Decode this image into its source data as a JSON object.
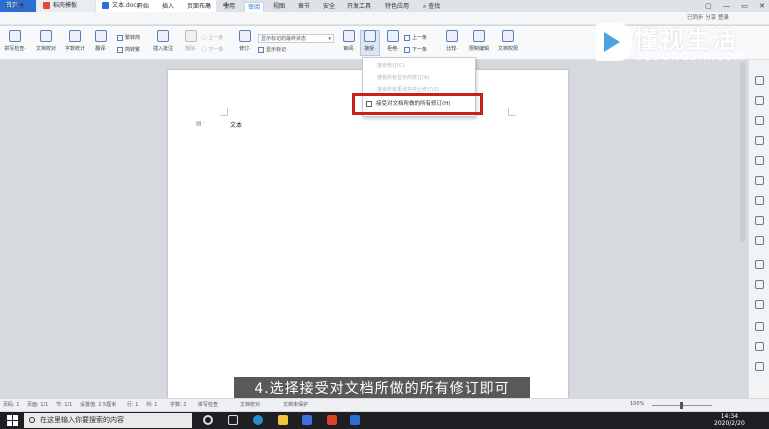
{
  "tabs": {
    "home": "首页",
    "template": "稻壳模板",
    "doc": "文本.docx",
    "add": "+"
  },
  "window_controls": [
    "▢",
    "—",
    "▭",
    "✕"
  ],
  "menu": {
    "file": "三 文件",
    "items": [
      "开始",
      "插入",
      "页面布局",
      "引用",
      "审阅",
      "视图",
      "章节",
      "安全",
      "开发工具",
      "特色应用"
    ],
    "search": "查找",
    "account": "已同步  分享  登录"
  },
  "ribbon": {
    "spell_check": "拼写检查·",
    "doc_proof": "文档校对",
    "word_count": "字数统计",
    "translate": "翻译·",
    "simp_trad": "繁转简",
    "trad_simp": "简转繁",
    "insert_comment": "插入批注",
    "delete": "删除·",
    "prev": "上一条",
    "next_dim": "下一条",
    "revise": "修订·",
    "markup_state": "显示标记的最终状态",
    "show_markup": "显示标记·",
    "review": "审阅·",
    "accept": "接受·",
    "reject": "拒绝·",
    "prev2": "上一条",
    "next2": "下一条",
    "compare": "比较·",
    "restrict_edit": "限制编辑",
    "doc_rights": "文档权限"
  },
  "dropdown": {
    "items": [
      "接受修订(C)",
      "接受所有显示的修订(A)",
      "接受所有更改并停止修订(S)"
    ],
    "accept_all": "接受对文档所做的所有修订(H)"
  },
  "document": {
    "text": "文本",
    "para_marker": "▤ ·"
  },
  "logo": {
    "cn": "懂视生活",
    "en": "51DONGSHI.COM"
  },
  "caption": "4.选择接受对文档所做的所有修订即可",
  "status": {
    "page_num": "页码: 1",
    "page": "页面: 1/1",
    "section": "节: 1/1",
    "setting": "设置值: 2.5厘米",
    "row": "行: 1",
    "col": "列: 1",
    "words": "字数: 2",
    "spell": "拼写检查",
    "proof": "文档校对",
    "protect": "文档未保护",
    "zoom": "100%"
  },
  "taskbar": {
    "search_placeholder": "在这里输入你要搜索的内容",
    "time": "14:34",
    "date": "2020/2/20"
  },
  "colors": {
    "accent": "#2d6fd1",
    "highlight_box": "#c81f1f",
    "taskbar": "#1f1f23"
  }
}
